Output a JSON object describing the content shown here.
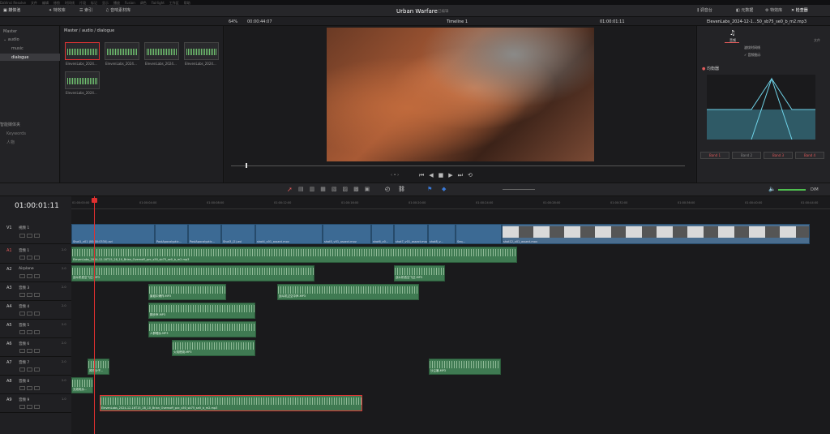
{
  "menu": [
    "DaVinci Resolve",
    "文件",
    "编辑",
    "修剪",
    "时间线",
    "片段",
    "标记",
    "显示",
    "播放",
    "Fusion",
    "调色",
    "Fairlight",
    "工作区",
    "帮助"
  ],
  "toolbar": {
    "media_pool": "媒体池",
    "effects": "特效库",
    "edit_index": "索引",
    "sound_library": "音响素材库",
    "mixer": "调音台",
    "metadata": "元数据",
    "inspector": "检查器",
    "fairlight_fx": "特效库"
  },
  "project": {
    "title": "Urban Warfare",
    "status": "已编辑"
  },
  "viewer": {
    "zoom": "64%",
    "timecode_src": "00:00:44:07",
    "timeline_name": "Timeline 1",
    "timecode": "01:00:01:11"
  },
  "inspector": {
    "clip": "ElevenLabs_2024-12-1...50_sb75_se0_b_m2.mp3",
    "tab_audio": "音频",
    "tab_file": "文件",
    "opt1": "波纹时间线",
    "opt2": "音频指示",
    "eq_label": "均衡器",
    "bands": [
      "Band 1",
      "Band 2",
      "Band 3",
      "Band 4"
    ],
    "band_colors": [
      "#e05a5a",
      "#888888",
      "#e05a5a",
      "#e05a5a"
    ]
  },
  "bins": {
    "master": "Master",
    "audio": "audio",
    "music": "music",
    "dialogue": "dialogue",
    "smart": "智能媒体夹",
    "keywords": "Keywords",
    "people": "人物"
  },
  "pool": {
    "path": "Master / audio / dialogue",
    "clips": [
      "ElevenLabs_2024...",
      "ElevenLabs_2024...",
      "ElevenLabs_2024...",
      "ElevenLabs_2024...",
      "ElevenLabs_2024..."
    ]
  },
  "timeline": {
    "timecode": "01:00:01:11",
    "ruler": [
      "01:00:00:00",
      "01:00:04:00",
      "01:00:08:00",
      "01:00:12:00",
      "01:00:16:00",
      "01:00:20:00",
      "01:00:24:00",
      "01:00:28:00",
      "01:00:32:00",
      "01:00:36:00",
      "01:00:40:00",
      "01:00:44:00"
    ],
    "dim": "DIM"
  },
  "tracks": [
    {
      "id": "V1",
      "name": "视频 1",
      "ch": ""
    },
    {
      "id": "A1",
      "name": "音频 1",
      "ch": "2.0"
    },
    {
      "id": "A2",
      "name": "Airplane",
      "ch": "2.0"
    },
    {
      "id": "A3",
      "name": "音频 3",
      "ch": "2.0"
    },
    {
      "id": "A4",
      "name": "音频 4",
      "ch": "2.0"
    },
    {
      "id": "A5",
      "name": "音频 5",
      "ch": "2.0"
    },
    {
      "id": "A6",
      "name": "音频 6",
      "ch": "2.0"
    },
    {
      "id": "A7",
      "name": "音频 7",
      "ch": "2.0"
    },
    {
      "id": "A8",
      "name": "音频 8",
      "ch": "2.0"
    },
    {
      "id": "A9",
      "name": "音频 9",
      "ch": "1.0"
    }
  ],
  "video_clips": [
    "Shot1_v01 (00:00:0330).avi",
    "PostApocalyptic...",
    "PostApocalyptic...",
    "Shot3_(2).avi",
    "shot4_v01_assect.mov",
    "shot5_v01_assect.mov",
    "shot6_v0...",
    "shot7_v01_assect.mov",
    "shot8_v...",
    "Seq...",
    "shot12_v01_assect.mov"
  ],
  "audio_clips": {
    "a1": "ElevenLabs_2024-12-16T15_28_10_Brian_Overnoff_pvc_s50_sb75_se0_b_m2.mp3",
    "a2a": "战斗机低空飞过.MP3",
    "a2b": "战斗机低空飞过.MP3",
    "a3a": "废墟中爆炸.MP3",
    "a3b": "战斗机过空中声.MP3",
    "a4": "脚步声.MP3",
    "a5": "人群嘈杂.MP3",
    "a6": "火焰燃烧.MP3",
    "a7a": "风吹沙子...",
    "a7b": "沙尘暴.MP3",
    "a8": "无线电杂...",
    "a9": "ElevenLabs_2024-12-16T15_28_10_Brian_Overnoff_pvc_s50_sb75_se0_b_m2.mp3"
  }
}
